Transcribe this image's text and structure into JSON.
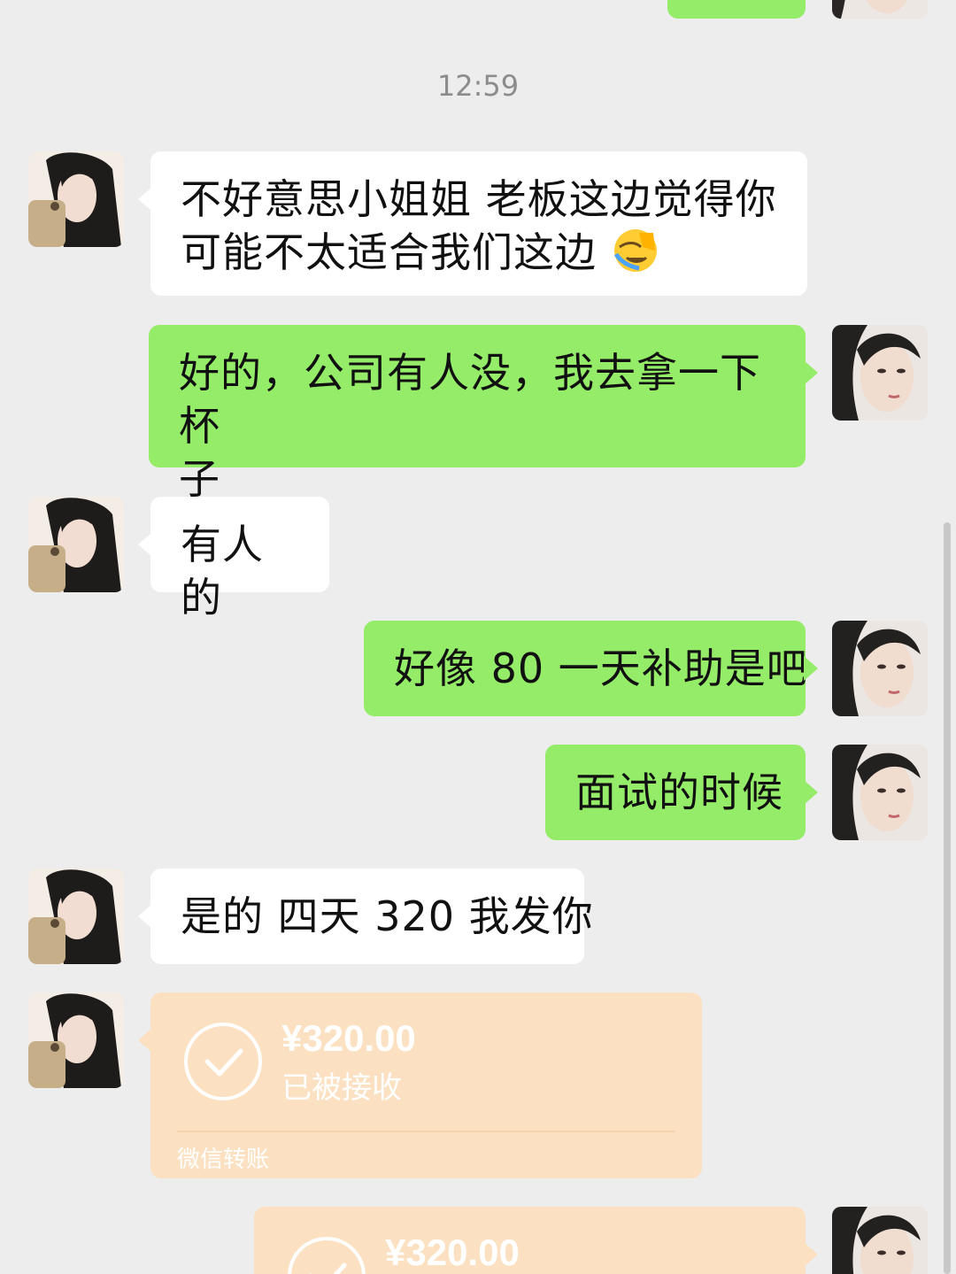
{
  "chat": {
    "timestamp": "12:59",
    "messages": [
      {
        "side": "in",
        "line1": "不好意思小姐姐  老板这边觉得你",
        "line2": "可能不太适合我们这边",
        "emoji": "facepalm-crying-emoji"
      },
      {
        "side": "out",
        "line1": "好的，公司有人没，我去拿一下杯",
        "line2": "子"
      },
      {
        "side": "in",
        "text": "有人的"
      },
      {
        "side": "out",
        "text": "好像 80 一天补助是吧"
      },
      {
        "side": "out",
        "text": "面试的时候"
      },
      {
        "side": "in",
        "text": "是的 四天 320 我发你"
      }
    ],
    "transfers": [
      {
        "side": "in",
        "amount": "¥320.00",
        "status": "已被接收",
        "footer": "微信转账",
        "icon": "check-circle-icon"
      },
      {
        "side": "out",
        "amount": "¥320.00",
        "icon": "check-circle-icon"
      }
    ]
  },
  "colors": {
    "background": "#ededed",
    "incoming_bubble": "#ffffff",
    "outgoing_bubble": "#95ec69",
    "transfer_card": "#fbe1c2"
  }
}
